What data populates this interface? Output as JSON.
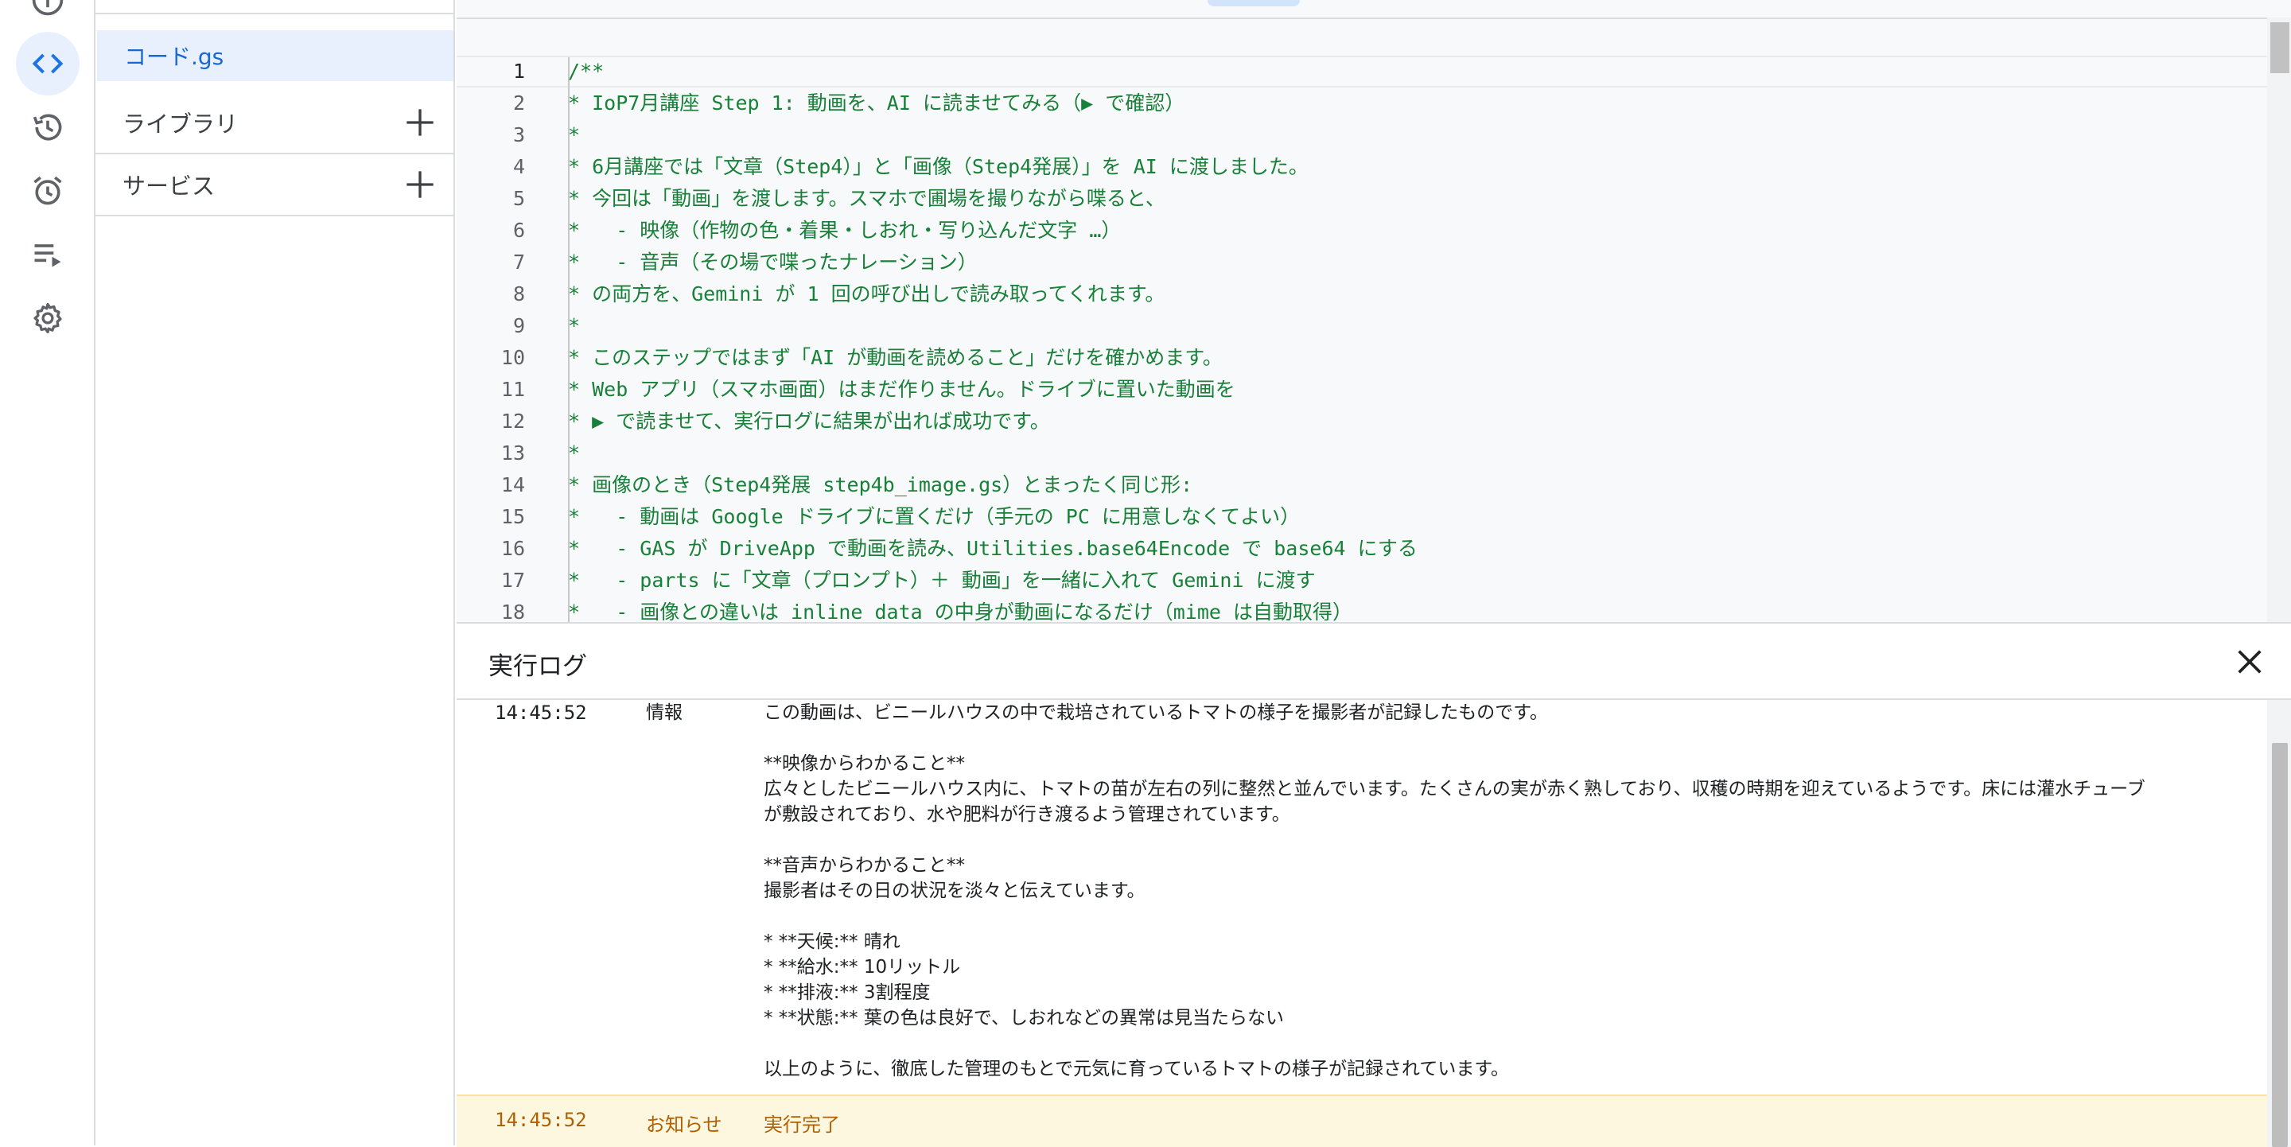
{
  "rail": {
    "icons": [
      "info-icon",
      "code-icon",
      "history-icon",
      "alarm-icon",
      "executions-icon",
      "settings-icon"
    ],
    "active": "code-icon",
    "accent": "#1a73e8"
  },
  "files": {
    "active_file": "コード.gs",
    "sections": [
      {
        "label": "ライブラリ"
      },
      {
        "label": "サービス"
      }
    ]
  },
  "editor": {
    "current_line": 1,
    "code_color": "#188038",
    "lines": [
      {
        "n": "1",
        "text": "/**"
      },
      {
        "n": "2",
        "text": "* IoP7月講座 Step 1: 動画を、AI に読ませてみる（▶ で確認）"
      },
      {
        "n": "3",
        "text": "*"
      },
      {
        "n": "4",
        "text": "* 6月講座では「文章（Step4）」と「画像（Step4発展）」を AI に渡しました。"
      },
      {
        "n": "5",
        "text": "* 今回は「動画」を渡します。スマホで圃場を撮りながら喋ると、"
      },
      {
        "n": "6",
        "text": "*   - 映像（作物の色・着果・しおれ・写り込んだ文字 …）"
      },
      {
        "n": "7",
        "text": "*   - 音声（その場で喋ったナレーション）"
      },
      {
        "n": "8",
        "text": "* の両方を、Gemini が 1 回の呼び出しで読み取ってくれます。"
      },
      {
        "n": "9",
        "text": "*"
      },
      {
        "n": "10",
        "text": "* このステップではまず「AI が動画を読めること」だけを確かめます。"
      },
      {
        "n": "11",
        "text": "* Web アプリ（スマホ画面）はまだ作りません。ドライブに置いた動画を"
      },
      {
        "n": "12",
        "text": "* ▶ で読ませて、実行ログに結果が出れば成功です。"
      },
      {
        "n": "13",
        "text": "*"
      },
      {
        "n": "14",
        "text": "* 画像のとき（Step4発展 step4b_image.gs）とまったく同じ形:"
      },
      {
        "n": "15",
        "text": "*   - 動画は Google ドライブに置くだけ（手元の PC に用意しなくてよい）"
      },
      {
        "n": "16",
        "text": "*   - GAS が DriveApp で動画を読み、Utilities.base64Encode で base64 にする"
      },
      {
        "n": "17",
        "text": "*   - parts に「文章（プロンプト）＋ 動画」を一緒に入れて Gemini に渡す"
      },
      {
        "n": "18",
        "text": "*   - 画像との違いは inline_data の中身が動画になるだけ（mime は自動取得）"
      }
    ]
  },
  "log": {
    "title": "実行ログ",
    "entries": [
      {
        "time": "14:45:52",
        "level": "情報",
        "lines": [
          "この動画は、ビニールハウスの中で栽培されているトマトの様子を撮影者が記録したものです。",
          "",
          "**映像からわかること**",
          "広々としたビニールハウス内に、トマトの苗が左右の列に整然と並んでいます。たくさんの実が赤く熟しており、収穫の時期を迎えているようです。床には灌水チューブ",
          "が敷設されており、水や肥料が行き渡るよう管理されています。",
          "",
          "**音声からわかること**",
          "撮影者はその日の状況を淡々と伝えています。",
          "",
          "* **天候:** 晴れ",
          "* **給水:** 10リットル",
          "* **排液:** 3割程度",
          "* **状態:** 葉の色は良好で、しおれなどの異常は見当たらない",
          "",
          "以上のように、徹底した管理のもとで元気に育っているトマトの様子が記録されています。"
        ]
      }
    ],
    "notice": {
      "time": "14:45:52",
      "level": "お知らせ",
      "message": "実行完了",
      "color": "#b06000",
      "background": "#fef7e0"
    }
  }
}
